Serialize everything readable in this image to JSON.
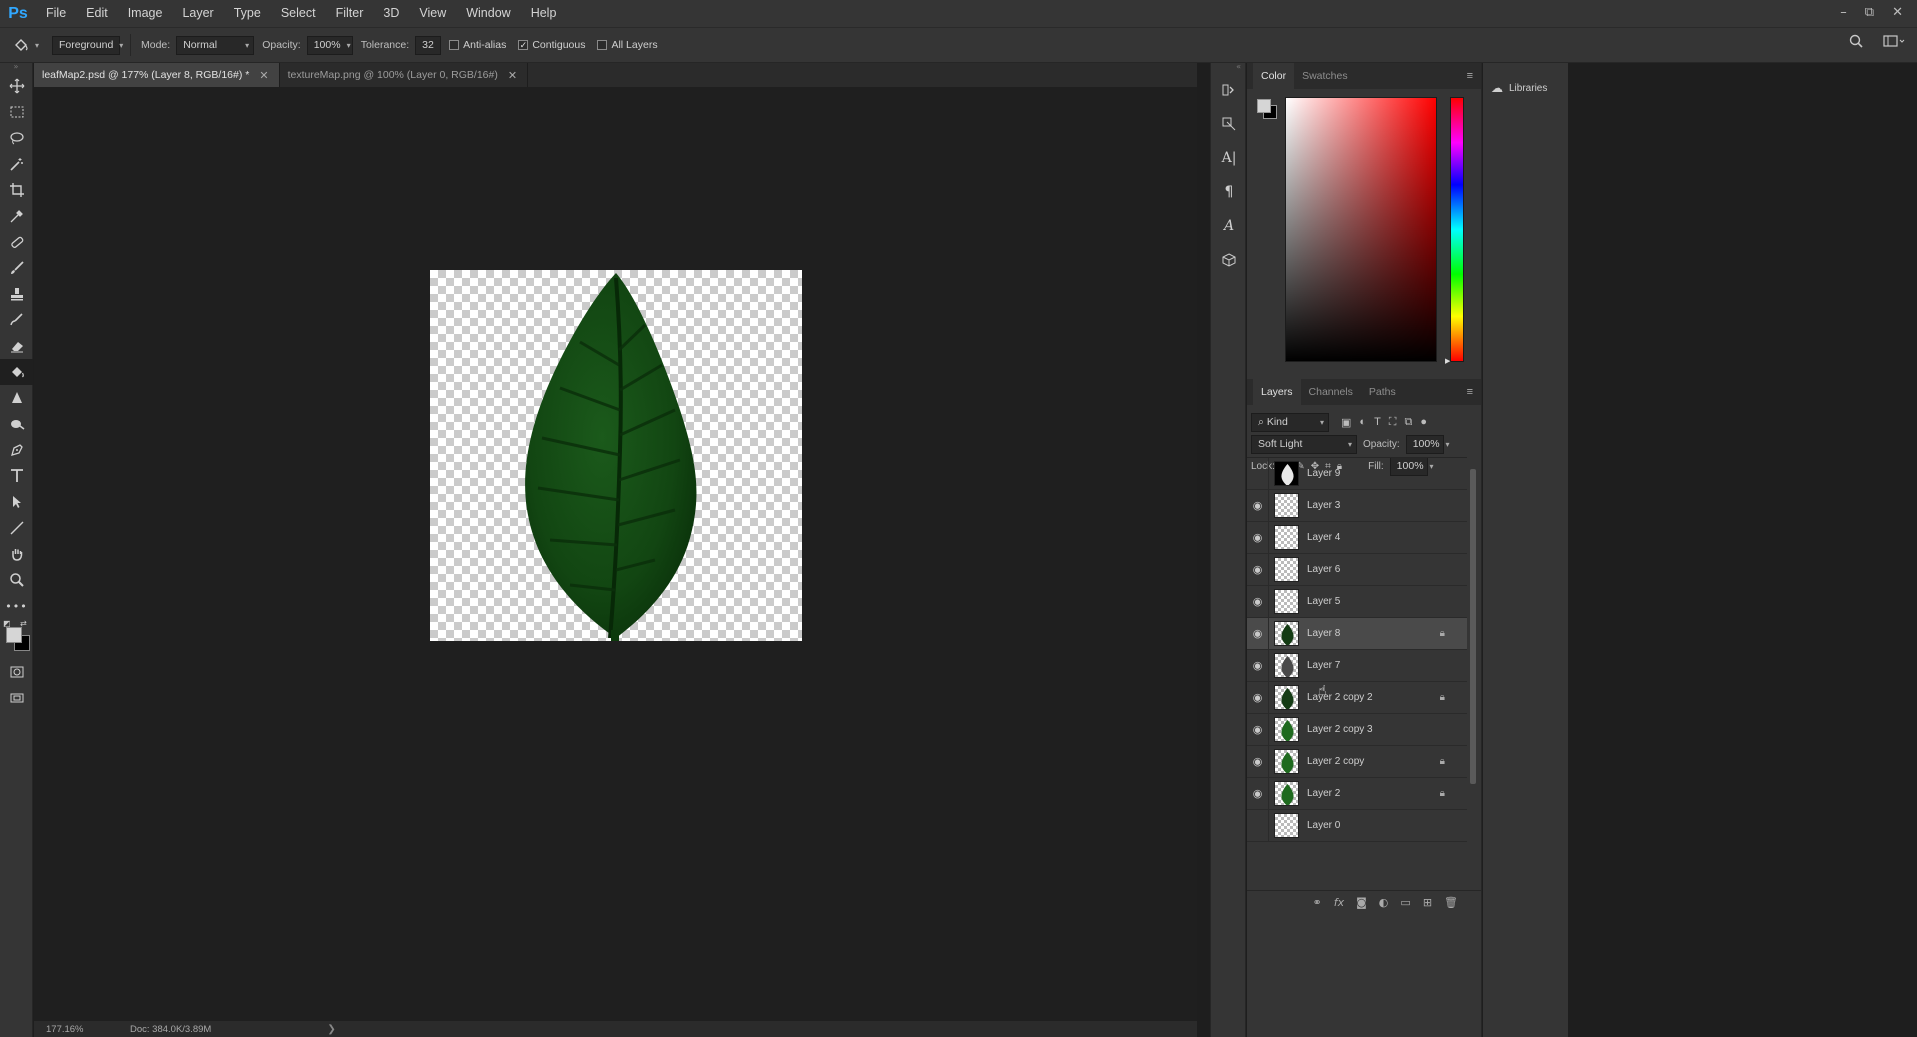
{
  "app": {
    "logo": "Ps"
  },
  "menu": [
    "File",
    "Edit",
    "Image",
    "Layer",
    "Type",
    "Select",
    "Filter",
    "3D",
    "View",
    "Window",
    "Help"
  ],
  "window_controls": {
    "minimize": "–",
    "restore": "⧉",
    "close": "✕"
  },
  "options": {
    "fill_source": "Foreground",
    "mode_label": "Mode:",
    "mode_value": "Normal",
    "opacity_label": "Opacity:",
    "opacity_value": "100%",
    "tolerance_label": "Tolerance:",
    "tolerance_value": "32",
    "anti_alias_label": "Anti-alias",
    "anti_alias_checked": false,
    "contiguous_label": "Contiguous",
    "contiguous_checked": true,
    "all_layers_label": "All Layers",
    "all_layers_checked": false
  },
  "tabs": [
    {
      "label": "leafMap2.psd @ 177% (Layer 8, RGB/16#) *",
      "active": true
    },
    {
      "label": "textureMap.png @ 100% (Layer 0, RGB/16#)",
      "active": false
    }
  ],
  "status": {
    "zoom": "177.16%",
    "doc": "Doc: 384.0K/3.89M",
    "more": "❯"
  },
  "color_panel": {
    "tabs": [
      "Color",
      "Swatches"
    ],
    "active": "Color",
    "foreground": "#d6d6d6",
    "background": "#000000"
  },
  "layers_panel": {
    "tabs": [
      "Layers",
      "Channels",
      "Paths"
    ],
    "active": "Layers",
    "kind_label": "Kind",
    "blend_mode": "Soft Light",
    "opacity_label": "Opacity:",
    "opacity_value": "100%",
    "lock_label": "Lock:",
    "fill_label": "Fill:",
    "fill_value": "100%",
    "layers": [
      {
        "name": "Layer 9",
        "visible": false,
        "thumb": "mask",
        "locked": false,
        "selected": false
      },
      {
        "name": "Layer 3",
        "visible": true,
        "thumb": "empty",
        "locked": false,
        "selected": false
      },
      {
        "name": "Layer 4",
        "visible": true,
        "thumb": "empty",
        "locked": false,
        "selected": false
      },
      {
        "name": "Layer 6",
        "visible": true,
        "thumb": "empty",
        "locked": false,
        "selected": false
      },
      {
        "name": "Layer 5",
        "visible": true,
        "thumb": "empty",
        "locked": false,
        "selected": false
      },
      {
        "name": "Layer 8",
        "visible": true,
        "thumb": "leaf-dark",
        "locked": true,
        "selected": true
      },
      {
        "name": "Layer 7",
        "visible": true,
        "thumb": "leaf-gray",
        "locked": false,
        "selected": false
      },
      {
        "name": "Layer 2 copy 2",
        "visible": true,
        "thumb": "leaf-dark",
        "locked": true,
        "selected": false
      },
      {
        "name": "Layer 2 copy 3",
        "visible": true,
        "thumb": "leaf-green",
        "locked": false,
        "selected": false
      },
      {
        "name": "Layer 2 copy",
        "visible": true,
        "thumb": "leaf-green",
        "locked": true,
        "selected": false
      },
      {
        "name": "Layer 2",
        "visible": true,
        "thumb": "leaf-green",
        "locked": true,
        "selected": false
      },
      {
        "name": "Layer 0",
        "visible": false,
        "thumb": "empty",
        "locked": false,
        "selected": false
      }
    ]
  },
  "libraries": {
    "label": "Libraries"
  }
}
